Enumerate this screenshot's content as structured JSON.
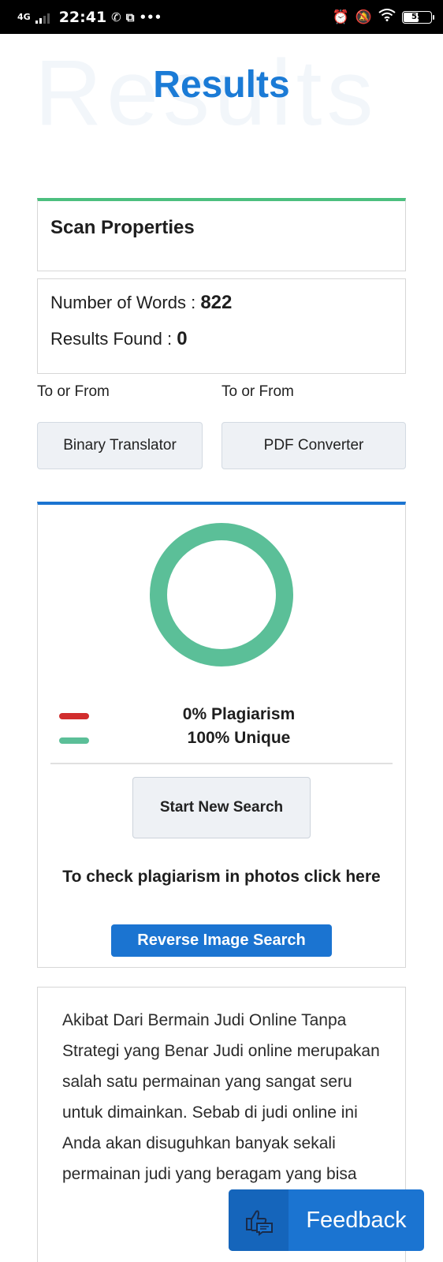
{
  "status_bar": {
    "network": "4G",
    "time": "22:41",
    "notif_icons": [
      "whatsapp-icon",
      "screenshot-icon",
      "more-dots-icon"
    ],
    "more": "•••",
    "right_icons": [
      "alarm-icon",
      "mute-icon",
      "wifi-icon",
      "battery-icon"
    ],
    "battery": "55"
  },
  "page": {
    "bg_title": "Results",
    "title": "Results"
  },
  "scan": {
    "heading": "Scan Properties",
    "words_label": "Number of Words : ",
    "words_value": "822",
    "results_label": "Results Found : ",
    "results_value": "0"
  },
  "tools": {
    "left_caption": "To or From",
    "right_caption": "To or From",
    "left_button": "Binary Translator",
    "right_button": "PDF Converter"
  },
  "result": {
    "plagiarism_text": "0% Plagiarism",
    "unique_text": "100% Unique",
    "plagiarism_percent": 0,
    "unique_percent": 100,
    "plagiarism_color": "#d12d2d",
    "unique_color": "#5bbf98",
    "new_search": "Start New Search",
    "photo_text": "To check plagiarism in photos click here",
    "reverse_button": "Reverse Image Search"
  },
  "article": {
    "text": "Akibat Dari Bermain Judi Online Tanpa Strategi yang Benar Judi online merupakan salah satu permainan yang sangat seru untuk dimainkan. Sebab di judi online ini Anda akan disuguhkan banyak sekali permainan judi yang beragam yang bisa"
  },
  "feedback": {
    "label": "Feedback",
    "icon": "thumbs-up-chat-icon"
  },
  "colors": {
    "accent_blue": "#1b74d1",
    "accent_green": "#4cbf7f"
  }
}
